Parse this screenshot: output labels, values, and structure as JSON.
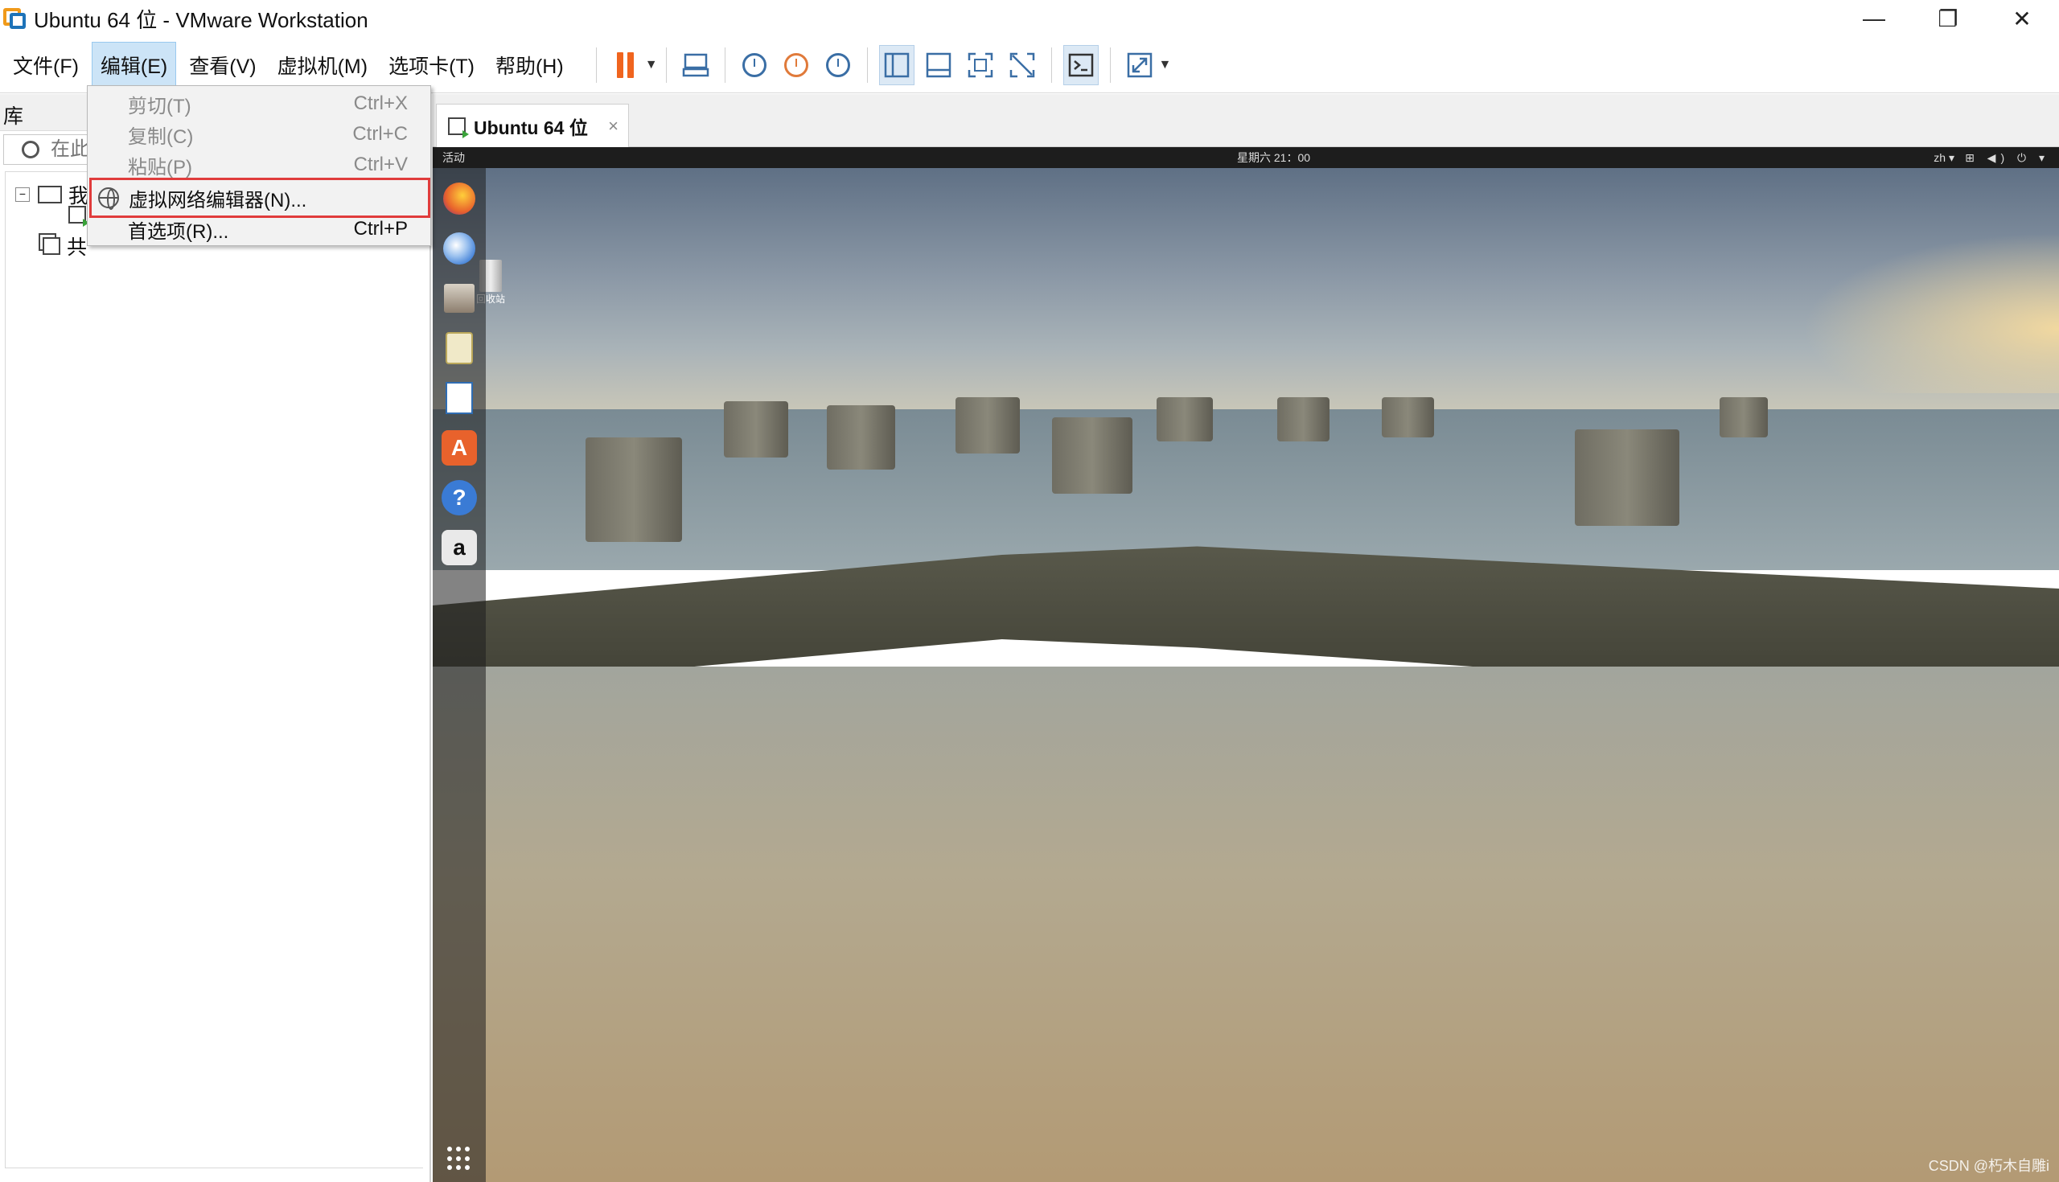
{
  "window": {
    "title": "Ubuntu 64 位 - VMware Workstation",
    "minimize": "—",
    "restore": "❐",
    "close": "✕"
  },
  "menubar": {
    "items": [
      "文件(F)",
      "编辑(E)",
      "查看(V)",
      "虚拟机(M)",
      "选项卡(T)",
      "帮助(H)"
    ],
    "active_index": 1
  },
  "toolbar": {
    "icons": [
      "pause-icon",
      "send-ctrl-alt-del-icon",
      "snapshot-icon",
      "revert-snapshot-icon",
      "snapshot-manager-icon",
      "library-view-icon",
      "thumbnail-bar-icon",
      "fullscreen-icon",
      "unity-icon",
      "console-icon",
      "stretch-icon"
    ],
    "pause_color": "#f0641e"
  },
  "library": {
    "title": "库",
    "search_placeholder": "在此",
    "tree": {
      "root_label": "我",
      "shared_label": "共"
    }
  },
  "edit_menu": {
    "items": [
      {
        "label": "剪切(T)",
        "shortcut": "Ctrl+X",
        "enabled": false
      },
      {
        "label": "复制(C)",
        "shortcut": "Ctrl+C",
        "enabled": false
      },
      {
        "label": "粘贴(P)",
        "shortcut": "Ctrl+V",
        "enabled": false
      },
      {
        "label": "虚拟网络编辑器(N)...",
        "shortcut": "",
        "enabled": true,
        "highlighted": true,
        "icon": "globe-icon"
      },
      {
        "label": "首选项(R)...",
        "shortcut": "Ctrl+P",
        "enabled": true
      }
    ],
    "highlight_color": "#e03c3c"
  },
  "vm_tab": {
    "label": "Ubuntu 64 位",
    "close": "×"
  },
  "guest": {
    "activities": "活动",
    "clock": "星期六 21：00",
    "lang": "zh ▾",
    "system_tray": "⊞ ◀) ⏻ ▾",
    "trash_label": "回收站",
    "dock": [
      {
        "name": "firefox-icon",
        "glyph": "",
        "color": "#e8622c"
      },
      {
        "name": "thunderbird-icon",
        "glyph": "",
        "color": "#3a7bd5"
      },
      {
        "name": "files-icon",
        "glyph": "",
        "color": "#9a8a7a"
      },
      {
        "name": "rhythmbox-icon",
        "glyph": "",
        "color": "#e7d27a"
      },
      {
        "name": "writer-icon",
        "glyph": "",
        "color": "#2f6db3"
      },
      {
        "name": "software-center-icon",
        "glyph": "A",
        "color": "#e8622c"
      },
      {
        "name": "help-icon",
        "glyph": "?",
        "color": "#3a7bd5"
      },
      {
        "name": "amazon-icon",
        "glyph": "a",
        "color": "#e9e9e9"
      }
    ]
  },
  "watermark": "CSDN @朽木自雕i"
}
